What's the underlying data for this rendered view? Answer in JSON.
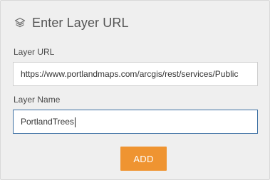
{
  "header": {
    "icon": "layers-icon",
    "title": "Enter Layer URL"
  },
  "layer_url": {
    "label": "Layer URL",
    "value": "https://www.portlandmaps.com/arcgis/rest/services/Public"
  },
  "layer_name": {
    "label": "Layer Name",
    "value": "PortlandTrees"
  },
  "add_button": {
    "label": "ADD",
    "color": "#ef9431"
  }
}
